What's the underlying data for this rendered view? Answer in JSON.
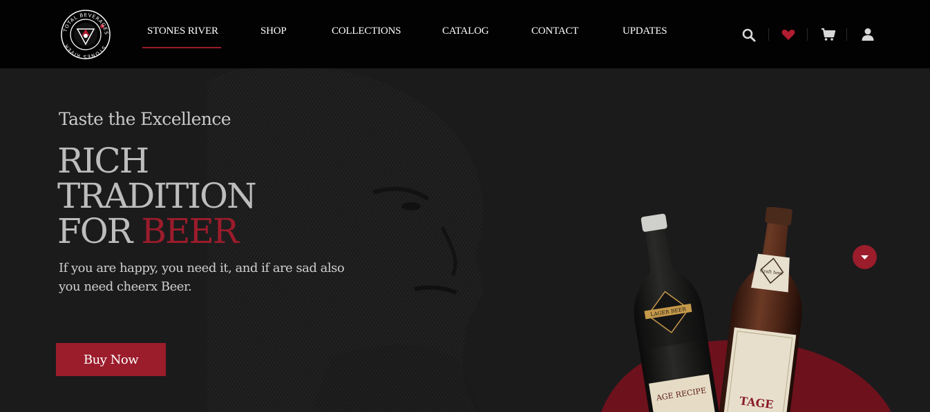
{
  "brand": {
    "logo_text_top": "TOTAL BEVERAGES",
    "logo_text_bottom": "STONES RIVER"
  },
  "nav": {
    "items": [
      {
        "label": "STONES RIVER",
        "active": true
      },
      {
        "label": "SHOP"
      },
      {
        "label": "COLLECTIONS"
      },
      {
        "label": "CATALOG"
      },
      {
        "label": "CONTACT"
      },
      {
        "label": "UPDATES"
      }
    ]
  },
  "header_icons": [
    "search-icon",
    "heart-icon",
    "cart-icon",
    "user-icon"
  ],
  "hero": {
    "tagline": "Taste the Excellence",
    "headline_line1": "RICH",
    "headline_line2": "TRADITION",
    "headline_line3_a": "FOR ",
    "headline_line3_b": "BEER",
    "subtitle": "If you are happy, you need it, and if are sad also you need cheerx Beer.",
    "cta": "Buy Now",
    "bottle_labels": [
      "LAGER BEER",
      "Craft beer",
      "AGE RECIPE",
      "TAGE"
    ]
  },
  "colors": {
    "accent": "#9b1c2b",
    "header_bg": "#020202",
    "hero_bg": "#1b1b1c"
  }
}
